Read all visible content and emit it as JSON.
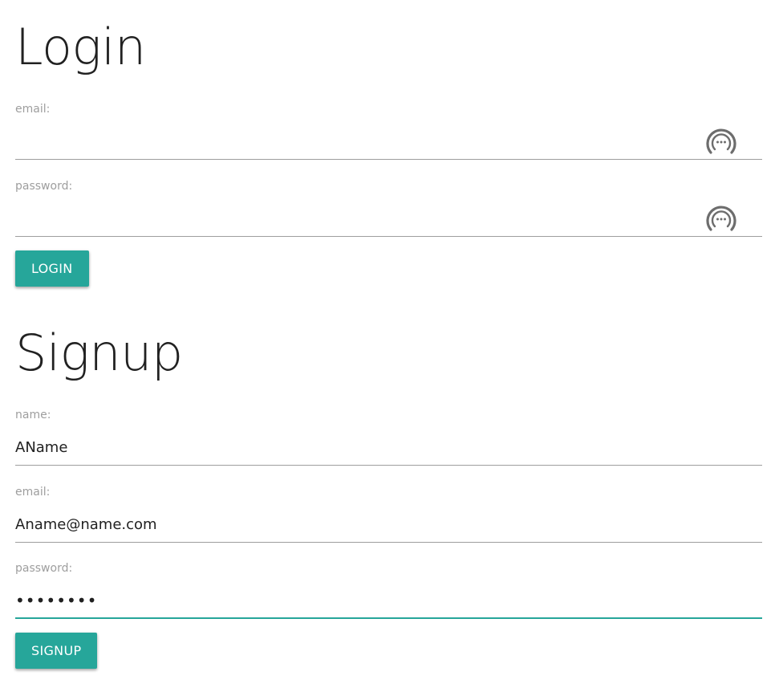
{
  "login": {
    "title": "Login",
    "email_label": "email:",
    "email_value": "",
    "password_label": "password:",
    "password_value": "",
    "button_label": "LOGIN"
  },
  "signup": {
    "title": "Signup",
    "name_label": "name:",
    "name_value": "AName",
    "email_label": "email:",
    "email_value": "Aname@name.com",
    "password_label": "password:",
    "password_value": "••••••••",
    "button_label": "SIGNUP"
  },
  "icons": {
    "password_manager": "password-manager-icon"
  },
  "colors": {
    "accent": "#26a69a",
    "label": "#9e9e9e",
    "underline": "#9e9e9e",
    "text": "#212121"
  }
}
